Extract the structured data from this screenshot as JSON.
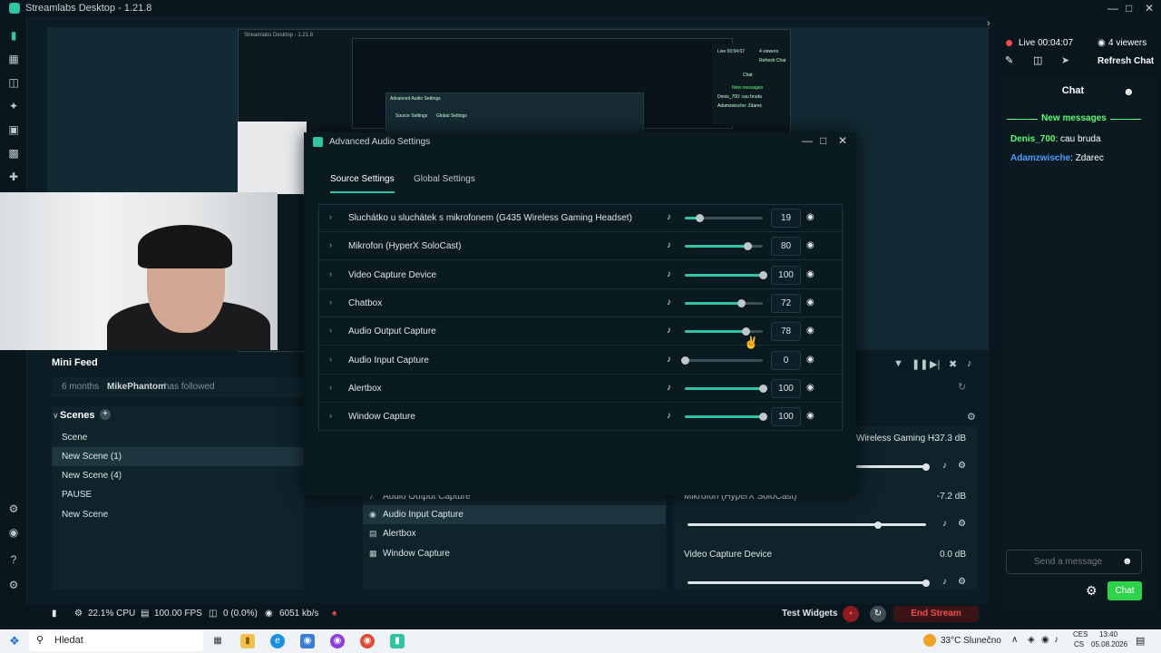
{
  "app": {
    "title": "Streamlabs Desktop - 1.21.8"
  },
  "nested": {
    "title": "Streamlabs Desktop - 1.21.8",
    "live": "Live 00:04:07",
    "viewers": "4 viewers",
    "refresh": "Refresh Chat",
    "chat": "Chat",
    "new_messages": "New messages",
    "m1": "Denis_700: cau bruda",
    "m2": "Adamzwische: Zdarec",
    "aas_title": "Advanced Audio Settings",
    "tab1": "Source Settings",
    "tab2": "Global Settings"
  },
  "mini_feed": {
    "title": "Mini Feed",
    "time": "6 months",
    "user": "MikePhantom",
    "action": "has followed"
  },
  "scenes": {
    "title": "Scenes",
    "items": [
      "Scene",
      "New Scene (1)",
      "New Scene (4)",
      "PAUSE",
      "New Scene"
    ],
    "selected": 1
  },
  "sources": {
    "items": [
      "Audio Output Capture",
      "Audio Input Capture",
      "Alertbox",
      "Window Capture"
    ]
  },
  "mixer": {
    "items": [
      {
        "name": "Wireless Gaming H...",
        "db": "-37.3 dB",
        "level": 1.0
      },
      {
        "name": "Mikrofon (HyperX SoloCast)",
        "db": "-7.2 dB",
        "level": 0.8
      },
      {
        "name": "Video Capture Device",
        "db": "0.0 dB",
        "level": 1.0
      }
    ]
  },
  "chat": {
    "live": "Live 00:04:07",
    "viewers": "4 viewers",
    "refresh": "Refresh Chat",
    "title": "Chat",
    "new_messages": "New messages",
    "messages": [
      {
        "user": "Denis_700",
        "text": ": cau bruda",
        "color": "#5dfc76"
      },
      {
        "user": "Adamzwische",
        "text": ": Zdarec",
        "color": "#4f9cff"
      }
    ],
    "placeholder": "Send a message",
    "send": "Chat"
  },
  "footer": {
    "cpu": "22.1% CPU",
    "fps": "100.00 FPS",
    "dropped": "0 (0.0%)",
    "bitrate": "6051 kb/s",
    "test_widgets": "Test Widgets",
    "end_stream": "End Stream"
  },
  "modal": {
    "title": "Advanced Audio Settings",
    "tabs": [
      "Source Settings",
      "Global Settings"
    ],
    "rows": [
      {
        "name": "Sluchátko u sluchátek s mikrofonem (G435 Wireless Gaming Headset)",
        "value": "19",
        "level": 0.19
      },
      {
        "name": "Mikrofon (HyperX SoloCast)",
        "value": "80",
        "level": 0.8
      },
      {
        "name": "Video Capture Device",
        "value": "100",
        "level": 1.0
      },
      {
        "name": "Chatbox",
        "value": "72",
        "level": 0.72
      },
      {
        "name": "Audio Output Capture",
        "value": "78",
        "level": 0.78
      },
      {
        "name": "Audio Input Capture",
        "value": "0",
        "level": 0.0
      },
      {
        "name": "Alertbox",
        "value": "100",
        "level": 1.0
      },
      {
        "name": "Window Capture",
        "value": "100",
        "level": 1.0
      }
    ]
  },
  "taskbar": {
    "search": "Hledat",
    "weather": "33°C Slunečno",
    "lang1": "CES",
    "lang2": "CS",
    "time": "13:40",
    "date": "05.08.2026"
  },
  "colors": {
    "accent": "#31c3a2",
    "chat_green": "#5dfc76",
    "live_red": "#f24c4c"
  }
}
